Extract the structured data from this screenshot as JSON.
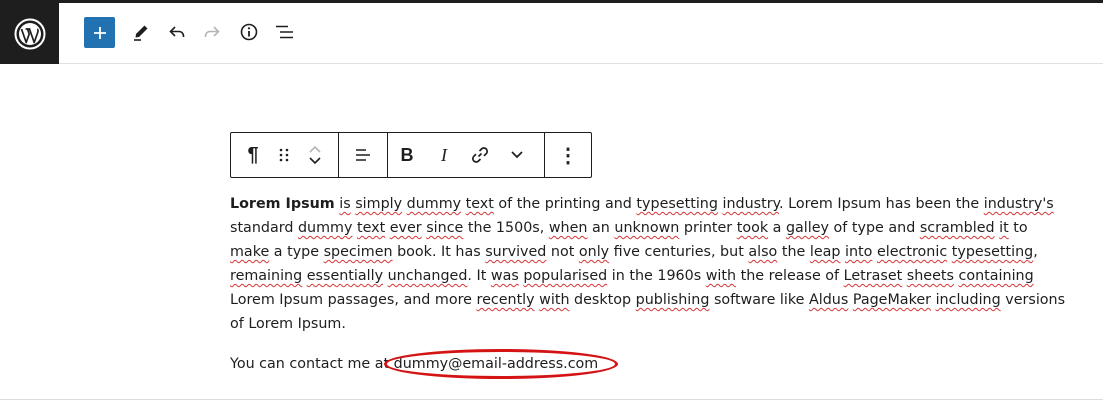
{
  "header": {
    "logo": "wordpress-logo",
    "tools": [
      {
        "name": "add-block-button",
        "icon": "plus-icon"
      },
      {
        "name": "tools-button",
        "icon": "pencil-icon"
      },
      {
        "name": "undo-button",
        "icon": "undo-icon"
      },
      {
        "name": "redo-button",
        "icon": "redo-icon"
      },
      {
        "name": "details-button",
        "icon": "info-icon"
      },
      {
        "name": "list-view-button",
        "icon": "list-view-icon"
      }
    ]
  },
  "block_toolbar": {
    "paragraph": "¶",
    "bold": "B",
    "italic": "I",
    "more": "⋮"
  },
  "content": {
    "paragraph1": {
      "bold_lead": "Lorem Ipsum",
      "p1": " ",
      "w1": "is",
      "p2": " ",
      "w2": "simply",
      "p3": " ",
      "w3": "dummy",
      "p4": " ",
      "w4": "text",
      "p5": " of the printing and ",
      "w5": "typesetting",
      "p6": " ",
      "w6": "industry",
      "p7": ". Lorem Ipsum has been the ",
      "w7": "industry's",
      "p8": " standard ",
      "w8": "dummy",
      "p9": " ",
      "w9": "text",
      "p10": " ",
      "w10": "ever",
      "p11": " ",
      "w11": "since",
      "p12": " the 1500s, ",
      "w12": "when",
      "p13": " an ",
      "w13": "unknown",
      "p14": " printer ",
      "w14": "took",
      "p15": " a ",
      "w15": "galley",
      "p16": " of type and ",
      "w16": "scrambled",
      "p17": " ",
      "w17": "it",
      "p18": " to ",
      "w18": "make",
      "p19": " a type ",
      "w19": "specimen",
      "p20": " book. It has ",
      "w20": "survived",
      "p21": " not ",
      "w21": "only",
      "p22": " five centuries, but ",
      "w22": "also",
      "p23": " the ",
      "w23": "leap",
      "p24": " ",
      "w24": "into",
      "p25": " ",
      "w25": "electronic",
      "p26": " ",
      "w26": "typesetting",
      "p27": ", ",
      "w27": "remaining",
      "p28": " ",
      "w28": "essentially",
      "p29": " ",
      "w29": "unchanged",
      "p30": ". It ",
      "w30": "was",
      "p31": " ",
      "w31": "popularised",
      "p32": " in the 1960s ",
      "w32": "with",
      "p33": " the release of ",
      "w33": "Letraset",
      "p34": " ",
      "w34": "sheets",
      "p35": " ",
      "w35": "containing",
      "p36": " Lorem Ipsum passages, and more ",
      "w36": "recently",
      "p37": " ",
      "w37": "with",
      "p38": " desktop ",
      "w38": "publishing",
      "p39": " software like ",
      "w39": "Aldus",
      "p40": " ",
      "w40": "PageMaker",
      "p41": " ",
      "w41": "including",
      "p42": " versions of Lorem Ipsum."
    },
    "paragraph2": {
      "text": "You can contact me at ",
      "email": "dummy@email-address.com"
    },
    "annotation_color": "#d41414"
  }
}
